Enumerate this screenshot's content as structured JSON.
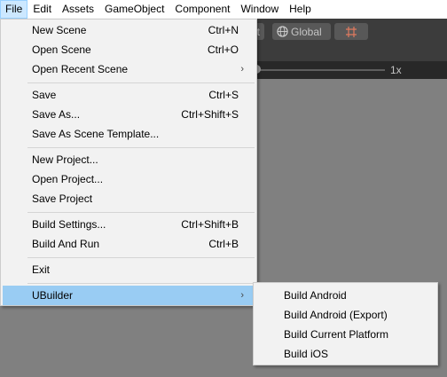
{
  "menubar": {
    "items": [
      {
        "label": "File",
        "active": true
      },
      {
        "label": "Edit"
      },
      {
        "label": "Assets"
      },
      {
        "label": "GameObject"
      },
      {
        "label": "Component"
      },
      {
        "label": "Window"
      },
      {
        "label": "Help"
      }
    ]
  },
  "toolbar": {
    "pivot_label_fragment": "t",
    "global_label": "Global",
    "zoom_label": "1x"
  },
  "file_menu": {
    "items": [
      {
        "label": "New Scene",
        "shortcut": "Ctrl+N"
      },
      {
        "label": "Open Scene",
        "shortcut": "Ctrl+O"
      },
      {
        "label": "Open Recent Scene",
        "submenu": true
      },
      {
        "label": "Save",
        "shortcut": "Ctrl+S"
      },
      {
        "label": "Save As...",
        "shortcut": "Ctrl+Shift+S"
      },
      {
        "label": "Save As Scene Template..."
      },
      {
        "label": "New Project..."
      },
      {
        "label": "Open Project..."
      },
      {
        "label": "Save Project"
      },
      {
        "label": "Build Settings...",
        "shortcut": "Ctrl+Shift+B"
      },
      {
        "label": "Build And Run",
        "shortcut": "Ctrl+B"
      },
      {
        "label": "Exit"
      },
      {
        "label": "UBuilder",
        "submenu": true,
        "highlighted": true
      }
    ],
    "submenu_arrow": "›"
  },
  "ubuilder_submenu": {
    "items": [
      {
        "label": "Build Android"
      },
      {
        "label": "Build Android (Export)"
      },
      {
        "label": "Build Current Platform"
      },
      {
        "label": "Build iOS"
      }
    ]
  },
  "colors": {
    "menubar_bg": "#ffffff",
    "menu_bg": "#f2f2f2",
    "highlight": "#99ccf3",
    "editor_bg": "#808080",
    "toolbar_bg": "#3c3c3c"
  }
}
